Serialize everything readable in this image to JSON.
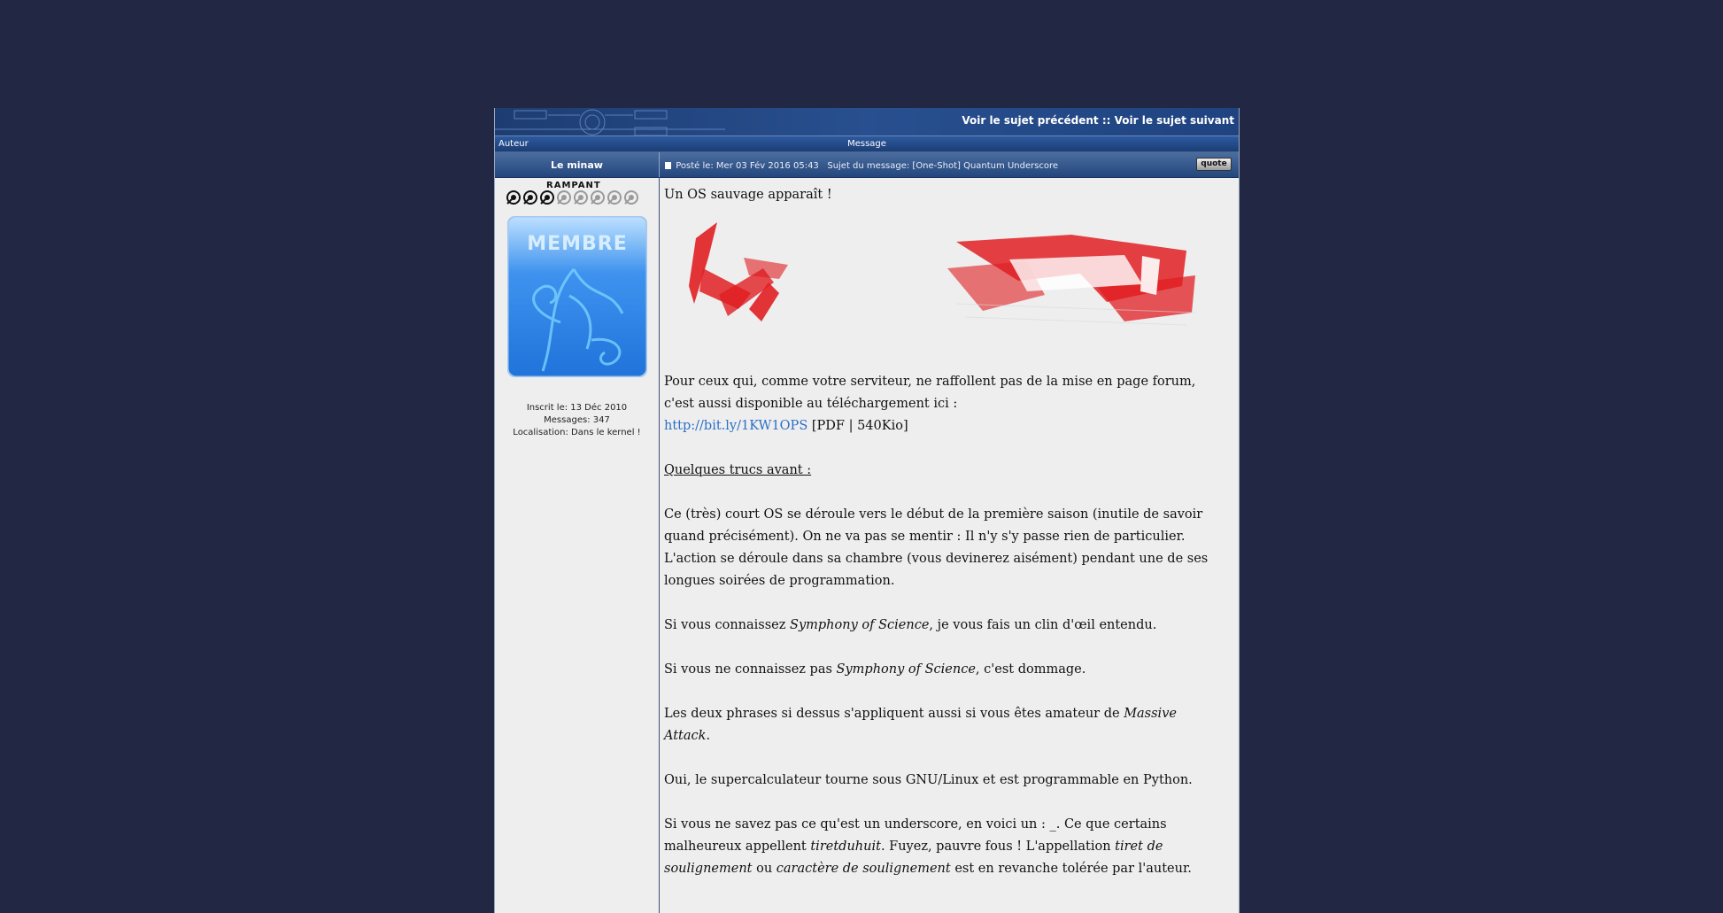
{
  "nav": {
    "prev": "Voir le sujet précédent",
    "separator": "::",
    "next": "Voir le sujet suivant"
  },
  "columns": {
    "author": "Auteur",
    "message": "Message"
  },
  "post": {
    "username": "Le minaw",
    "posted": "Posté le: Mer 03 Fév 2016 05:43",
    "subject": "Sujet du message: [One-Shot] Quantum Underscore",
    "quote_label": "quote"
  },
  "author": {
    "rank_label": "RAMPANT",
    "rank_filled": 3,
    "rank_total": 8,
    "avatar_text": "MEMBRE",
    "joined": "Inscrit le: 13 Déc 2010",
    "messages": "Messages: 347",
    "location": "Localisation: Dans le kernel !"
  },
  "message": {
    "line1": "Un OS sauvage apparaît !",
    "p1a": "Pour ceux qui, comme votre serviteur, ne raffollent pas de la mise en page forum, c'est aussi disponible au téléchargement ici :",
    "link": "http://bit.ly/1KW1OPS",
    "p1b": "[PDF | 540Kio]",
    "heading": "Quelques trucs avant :",
    "p2": "Ce (très) court OS se déroule vers le début de la première saison (inutile de savoir quand précisément). On ne va pas se mentir : Il n'y s'y passe rien de particulier. L'action se déroule dans sa chambre (vous devinerez aisément) pendant une de ses longues soirées de programmation.",
    "p3a": "Si vous connaissez",
    "p3i": "Symphony of Science",
    "p3b": ", je vous fais un clin d'œil entendu.",
    "p4a": "Si vous ne connaissez pas",
    "p4i": "Symphony of Science",
    "p4b": ", c'est dommage.",
    "p5a": "Les deux phrases si dessus s'appliquent aussi si vous êtes amateur de",
    "p5i": "Massive Attack",
    "p5b": ".",
    "p6": "Oui, le supercalculateur tourne sous GNU/Linux et est programmable en Python.",
    "p7a": "Si vous ne savez pas ce qu'est un underscore, en voici un : _. Ce que certains malheureux appellent",
    "p7i1": "tiretduhuit",
    "p7b": ". Fuyez, pauvre fous ! L'appellation",
    "p7i2": "tiret de soulignement",
    "p7c": "ou",
    "p7i3": "caractère de soulignement",
    "p7d": "est en revanche tolérée par l'auteur."
  },
  "colors": {
    "page_bg": "#222743",
    "header_blue": "#23467d",
    "link": "#2a6fc9",
    "banner_red": "#e01e22"
  }
}
